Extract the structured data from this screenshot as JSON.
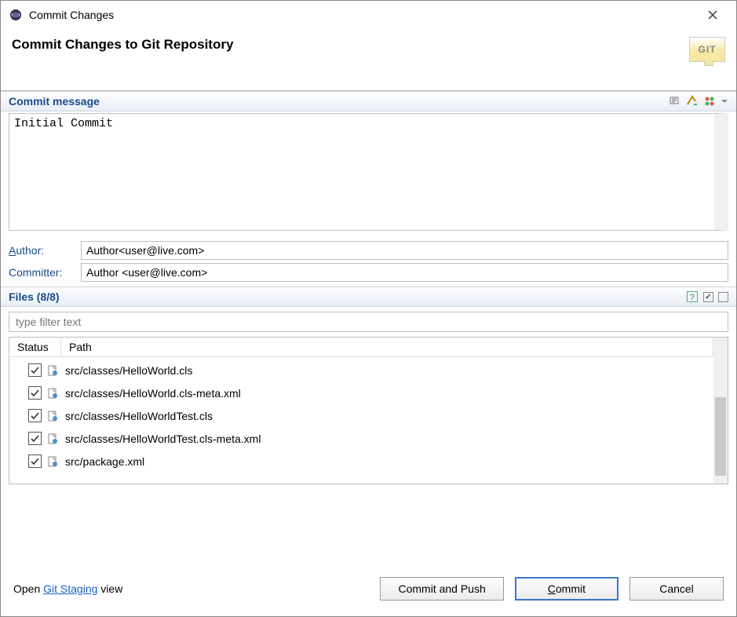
{
  "window": {
    "title": "Commit Changes"
  },
  "header": {
    "title": "Commit Changes to Git Repository",
    "badge_text": "GIT"
  },
  "commit_message_section": {
    "label": "Commit message",
    "value": "Initial Commit"
  },
  "author": {
    "label": "Author:",
    "value": "Author<user@live.com>"
  },
  "committer": {
    "label": "Committer:",
    "value": "Author <user@live.com>"
  },
  "files_section": {
    "label": "Files (8/8)",
    "filter_placeholder": "type filter text",
    "columns": {
      "status": "Status",
      "path": "Path"
    },
    "rows": [
      {
        "checked": true,
        "path": "src/classes/HelloWorld.cls"
      },
      {
        "checked": true,
        "path": "src/classes/HelloWorld.cls-meta.xml"
      },
      {
        "checked": true,
        "path": "src/classes/HelloWorldTest.cls"
      },
      {
        "checked": true,
        "path": "src/classes/HelloWorldTest.cls-meta.xml"
      },
      {
        "checked": true,
        "path": "src/package.xml"
      }
    ]
  },
  "staging": {
    "prefix": "Open ",
    "link": "Git Staging",
    "suffix": " view"
  },
  "buttons": {
    "commit_push": "Commit and Push",
    "commit": "ommit",
    "commit_ul": "C",
    "cancel": "Cancel"
  }
}
